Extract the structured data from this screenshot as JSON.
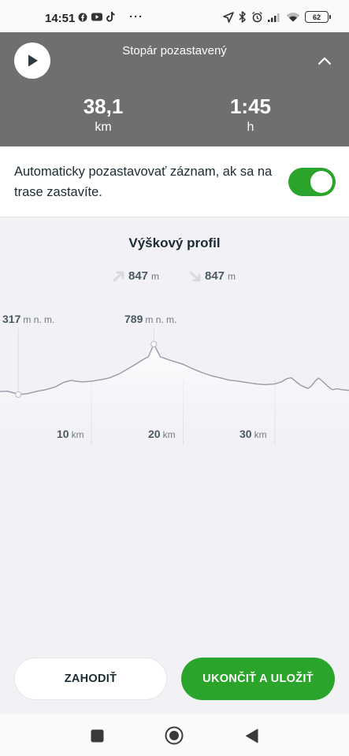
{
  "status_bar": {
    "time": "14:51",
    "app_icons": [
      "facebook-icon",
      "youtube-icon",
      "tiktok-icon"
    ],
    "more": "···",
    "battery": "62"
  },
  "header": {
    "title": "Stopár pozastavený",
    "distance": {
      "value": "38,1",
      "unit": "km"
    },
    "duration": {
      "value": "1:45",
      "unit": "h"
    }
  },
  "autopause": {
    "text": "Automaticky pozastavovať záznam, ak sa na trase zastavíte.",
    "enabled": true
  },
  "elevation": {
    "title": "Výškový profil",
    "ascent": {
      "value": "847",
      "unit": "m"
    },
    "descent": {
      "value": "847",
      "unit": "m"
    },
    "min": {
      "value": "317",
      "unit": "m n. m."
    },
    "max": {
      "value": "789",
      "unit": "m n. m."
    }
  },
  "chart_data": {
    "type": "area",
    "title": "Výškový profil",
    "xlabel": "",
    "ylabel": "",
    "x_unit": "km",
    "x_ticks": [
      {
        "value": 10,
        "label": "10",
        "unit": "km"
      },
      {
        "value": 20,
        "label": "20",
        "unit": "km"
      },
      {
        "value": 30,
        "label": "30",
        "unit": "km"
      }
    ],
    "xlim": [
      0,
      38.1
    ],
    "ylim": [
      250,
      850
    ],
    "min_marker": {
      "x": 2,
      "y": 317
    },
    "max_marker": {
      "x": 16.8,
      "y": 789
    },
    "x": [
      0,
      0.8,
      1.5,
      2,
      3,
      4,
      5,
      6,
      7,
      7.8,
      8.4,
      9,
      10,
      11,
      12,
      13,
      14,
      15,
      15.7,
      16.2,
      16.8,
      17.5,
      18.5,
      20,
      21,
      22,
      23,
      24,
      25,
      26,
      27,
      28,
      29,
      30,
      30.7,
      31.3,
      31.8,
      32.3,
      32.9,
      33.6,
      34,
      34.4,
      34.8,
      35.3,
      35.8,
      36.3,
      36.8,
      37.4,
      38.1
    ],
    "y": [
      345,
      348,
      333,
      317,
      325,
      347,
      363,
      387,
      433,
      449,
      440,
      436,
      442,
      456,
      474,
      510,
      560,
      611,
      648,
      671,
      789,
      670,
      640,
      600,
      560,
      524,
      495,
      474,
      452,
      442,
      429,
      416,
      410,
      416,
      435,
      465,
      474,
      438,
      400,
      374,
      397,
      444,
      471,
      435,
      393,
      361,
      371,
      362,
      356
    ]
  },
  "actions": {
    "discard": "ZAHODIŤ",
    "finish_save": "UKONČIŤ A ULOŽIŤ"
  },
  "colors": {
    "header_bg": "#6f6f6f",
    "accent_green": "#2aa42a",
    "chart_line": "#9a9aa8",
    "page_bg": "#f2f1f6"
  }
}
